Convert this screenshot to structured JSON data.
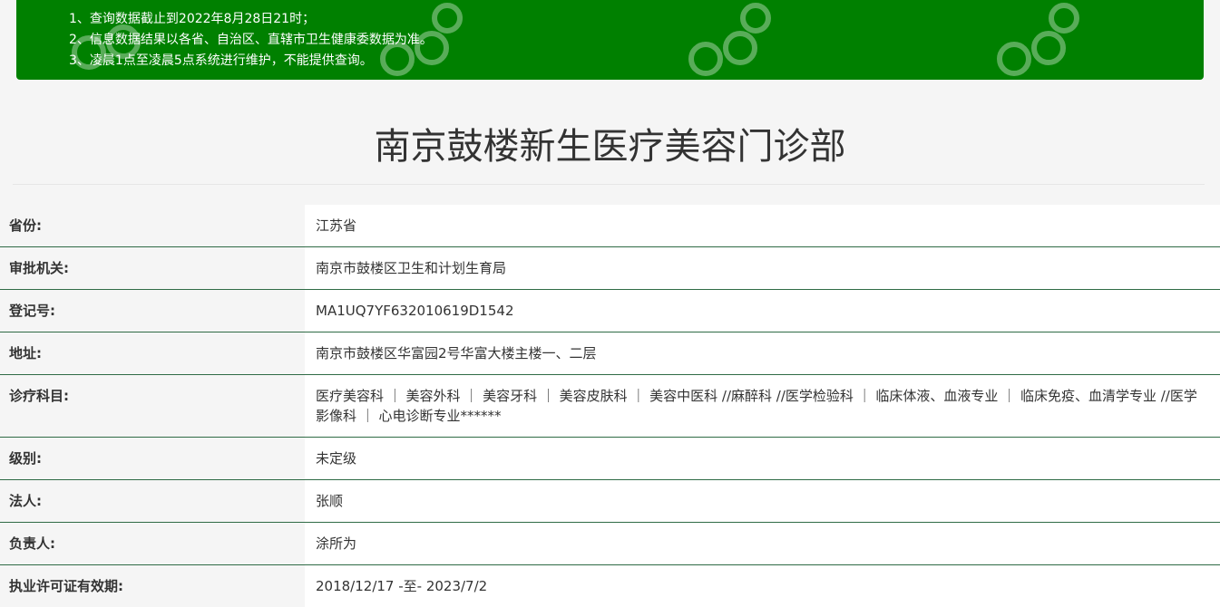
{
  "notice": {
    "lines": [
      "1、查询数据截止到2022年8月28日21时；",
      "2、信息数据结果以各省、自治区、直辖市卫生健康委数据为准。",
      "3、凌晨1点至凌晨5点系统进行维护，不能提供查询。"
    ],
    "background_color": "#008000",
    "text_color": "#ffffff"
  },
  "page": {
    "title": "南京鼓楼新生医疗美容门诊部"
  },
  "details": [
    {
      "label": "省份:",
      "value": "江苏省"
    },
    {
      "label": "审批机关:",
      "value": "南京市鼓楼区卫生和计划生育局"
    },
    {
      "label": "登记号:",
      "value": "MA1UQ7YF632010619D1542"
    },
    {
      "label": "地址:",
      "value": "南京市鼓楼区华富园2号华富大楼主楼一、二层"
    },
    {
      "label": "诊疗科目:",
      "value": "医疗美容科 ｜ 美容外科 ｜ 美容牙科 ｜ 美容皮肤科 ｜ 美容中医科 //麻醉科 //医学检验科 ｜ 临床体液、血液专业 ｜ 临床免疫、血清学专业 //医学影像科 ｜ 心电诊断专业******"
    },
    {
      "label": "级别:",
      "value": "未定级"
    },
    {
      "label": "法人:",
      "value": "张顺"
    },
    {
      "label": "负责人:",
      "value": "涂所为"
    },
    {
      "label": "执业许可证有效期:",
      "value": "2018/12/17 -至- 2023/7/2"
    }
  ],
  "colors": {
    "accent_green": "#008000",
    "row_divider": "#2f6b45",
    "label_background": "#f5f5f5",
    "value_background": "#ffffff"
  },
  "watermark": {
    "icon": "watermark-logo-icon"
  }
}
